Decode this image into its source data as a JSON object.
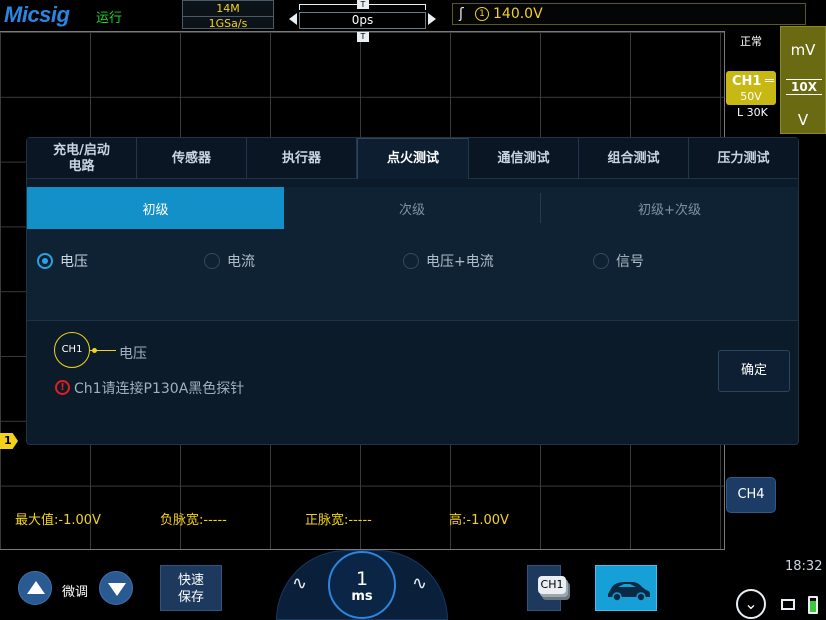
{
  "header": {
    "logo": "Micsig",
    "run_state": "运行",
    "memory_depth": "14M",
    "sample_rate": "1GSa/s",
    "time_offset": "0ps",
    "trigger_marker": "T",
    "trigger_source": "1",
    "trigger_level": "140.0V"
  },
  "right_panel": {
    "mode": "正常",
    "ch1": {
      "name": "CH1",
      "scale": "50V",
      "sub": "L 30K"
    },
    "scale_unit_top": "mV",
    "probe_ratio": "10X",
    "scale_unit_bottom": "V",
    "ch4": "CH4"
  },
  "channel_marker": "1",
  "measurements": [
    {
      "text": "最大值:-1.00V"
    },
    {
      "text": "负脉宽:-----"
    },
    {
      "text": "正脉宽:-----"
    },
    {
      "text": "高:-1.00V"
    }
  ],
  "dialog": {
    "tabs": [
      {
        "label": "充电/启动\n电路"
      },
      {
        "label": "传感器"
      },
      {
        "label": "执行器"
      },
      {
        "label": "点火测试"
      },
      {
        "label": "通信测试"
      },
      {
        "label": "组合测试"
      },
      {
        "label": "压力测试"
      }
    ],
    "active_tab": "点火测试",
    "subtabs": [
      "初级",
      "次级",
      "初级+次级"
    ],
    "active_subtab": "初级",
    "radios": [
      {
        "label": "电压",
        "checked": true
      },
      {
        "label": "电流",
        "checked": false
      },
      {
        "label": "电压+电流",
        "checked": false
      },
      {
        "label": "信号",
        "checked": false
      }
    ],
    "connection_channel": "CH1",
    "connection_label": "电压",
    "warning": "Ch1请连接P130A黑色探针",
    "confirm_button": "确定"
  },
  "bottom": {
    "fine_label": "微调",
    "quick_save": "快速\n保存",
    "timebase_value": "1",
    "timebase_unit": "ms",
    "ch1_chip": "CH1",
    "clock": "18:32"
  },
  "colors": {
    "ch1": "#f4d21c",
    "accent": "#1490c8",
    "run": "#26d126"
  }
}
